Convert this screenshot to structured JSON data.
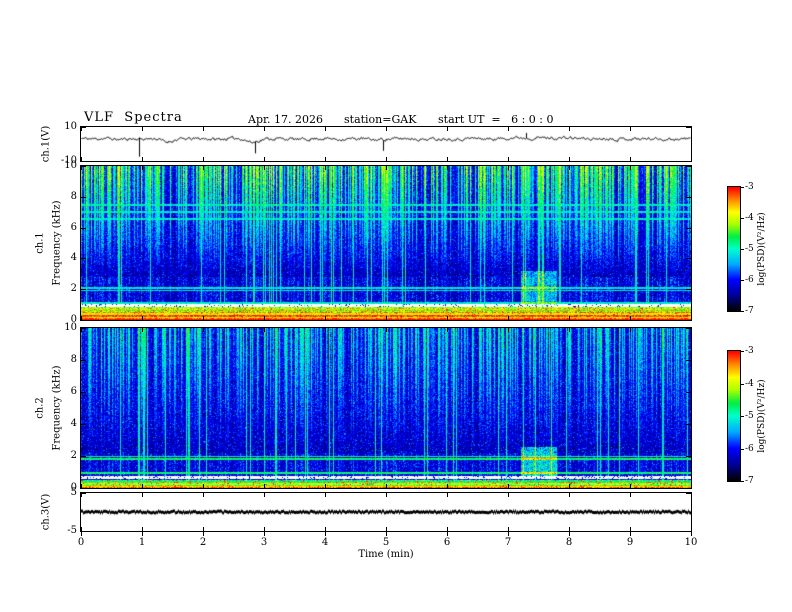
{
  "header": {
    "title": "VLF  Spectra",
    "date": "Apr. 17. 2026",
    "station": "station=GAK",
    "start_ut": "start UT  =   6 : 0 : 0"
  },
  "time_axis": {
    "label": "Time (min)",
    "min": 0,
    "max": 10,
    "tick_labels": [
      "0",
      "1",
      "2",
      "3",
      "4",
      "5",
      "6",
      "7",
      "8",
      "9",
      "10"
    ]
  },
  "colorbars": [
    {
      "label": "log(PSD)(V²/Hz)",
      "min": -7,
      "max": -3,
      "tick_labels": [
        "-3",
        "-4",
        "-5",
        "-6",
        "-7"
      ]
    },
    {
      "label": "log(PSD)(V²/Hz)",
      "min": -7,
      "max": -3,
      "tick_labels": [
        "-3",
        "-4",
        "-5",
        "-6",
        "-7"
      ]
    }
  ],
  "colormap_stops": [
    {
      "v": -7.0,
      "color": "#000000"
    },
    {
      "v": -6.5,
      "color": "#000099"
    },
    {
      "v": -6.0,
      "color": "#0000ff"
    },
    {
      "v": -5.5,
      "color": "#00aaff"
    },
    {
      "v": -5.0,
      "color": "#00ffcc"
    },
    {
      "v": -4.6,
      "color": "#00ee44"
    },
    {
      "v": -4.2,
      "color": "#aaff00"
    },
    {
      "v": -3.8,
      "color": "#ffff00"
    },
    {
      "v": -3.4,
      "color": "#ff8800"
    },
    {
      "v": -3.0,
      "color": "#ff0000"
    }
  ],
  "chart_data": [
    {
      "type": "line",
      "name": "ch1_voltage",
      "ylabel": "ch.1(V)",
      "ylim": [
        -10,
        10
      ],
      "ytick_labels": [
        "10",
        "-10"
      ],
      "description": "Noisy broadband voltage trace fluctuating around +3 V for the full 10 minutes, with brief downward excursions near t=1.4, 2.8 and 5 min and a slightly elevated level near t=7-8 min.",
      "seed": 11,
      "noise_amp": 1.5,
      "keyframes": [
        3.2,
        3.0,
        3.4,
        2.6,
        3.1,
        2.9,
        3.3,
        1.2,
        2.8,
        3.0,
        3.2,
        2.7,
        3.1,
        3.4,
        0.8,
        2.9,
        3.2,
        3.0,
        2.6,
        3.1,
        3.3,
        2.8,
        3.0,
        3.2,
        2.4,
        2.9,
        3.1,
        3.3,
        2.7,
        3.0,
        3.2,
        2.8,
        3.4,
        3.1,
        2.9,
        3.6,
        3.8,
        3.5,
        3.7,
        3.4,
        3.6,
        3.2,
        3.0,
        3.3,
        2.9,
        3.1,
        3.0,
        3.2,
        2.8,
        3.0,
        3.1
      ],
      "spikes": [
        {
          "t": 0.95,
          "v": -7.5
        },
        {
          "t": 2.85,
          "v": -5.5
        },
        {
          "t": 4.95,
          "v": -4.0
        },
        {
          "t": 7.3,
          "v": 6.5
        }
      ]
    },
    {
      "type": "heatmap",
      "name": "ch1_spectrogram",
      "channel": "ch.1",
      "ylabel": "Frequency (kHz)",
      "ylim": [
        0,
        10
      ],
      "ytick_labels": [
        "10",
        "8",
        "6",
        "4",
        "2",
        "0"
      ],
      "value_range": [
        -7,
        -3
      ],
      "units": "log10 PSD (V²/Hz)",
      "seed": 23,
      "features": {
        "background_psd": -6.85,
        "sferic_streaks": {
          "density": 0.9,
          "top_psd": -3.8,
          "low_freq_cutoff_khz": 2.8,
          "full_height_threshold": 0.93
        },
        "horizontal_lines_khz": [
          1.15,
          1.95,
          2.1,
          6.6,
          7.05,
          7.5
        ],
        "line_psd": -5.1,
        "white_gap_khz": [
          0.9,
          1.05
        ],
        "intense_band": {
          "freq_khz": [
            0,
            0.88
          ],
          "psd": -3.7,
          "red_speckle": 0.04
        },
        "enhancement": {
          "t_min": [
            7.2,
            7.8
          ],
          "freq_khz": [
            1.0,
            3.2
          ],
          "psd_boost": 1.1
        }
      },
      "description": "Dense vertical sferic striations (green/yellow) strongest above ~5 kHz on near-black background; scattered blue speckle below 3 kHz; thin cyan horizontal lines near 2 and 6.6-7.5 kHz; quasi-continuous intense red/yellow band below ~0.9 kHz with a white gap just above it; cyan enhancement near t=7.5 min at 1-3 kHz."
    },
    {
      "type": "heatmap",
      "name": "ch2_spectrogram",
      "channel": "ch.2",
      "ylabel": "Frequency (kHz)",
      "ylim": [
        0,
        10
      ],
      "ytick_labels": [
        "10",
        "8",
        "6",
        "4",
        "2",
        "0"
      ],
      "value_range": [
        -7,
        -3
      ],
      "units": "log10 PSD (V²/Hz)",
      "seed": 57,
      "features": {
        "background_psd": -6.8,
        "sferic_streaks": {
          "density": 0.6,
          "top_psd": -4.5,
          "low_freq_cutoff_khz": 2.2,
          "full_height_threshold": 0.9
        },
        "horizontal_lines_khz": [
          0.95,
          1.85,
          2.0
        ],
        "line_psd": -4.7,
        "white_gap_khz": [
          0.6,
          0.78
        ],
        "intense_band": {
          "freq_khz": [
            0,
            0.55
          ],
          "psd": -4.2,
          "red_speckle": 0.06
        },
        "enhancement": {
          "t_min": [
            7.2,
            7.8
          ],
          "freq_khz": [
            0.8,
            2.6
          ],
          "psd_boost": 1.3
        }
      },
      "description": "Blue-dominated spectrogram with vertical sferic streaks across all 10 minutes, bright green horizontal lines near 1 and 2 kHz, green/cyan band with red speckles below ~0.55 kHz, cyan enhancement near t=7.5 min."
    },
    {
      "type": "line",
      "name": "ch3_voltage",
      "ylabel": "ch.3(V)",
      "ylim": [
        -5,
        5
      ],
      "ytick_labels": [
        "5",
        "-5"
      ],
      "style": "dotted-flat",
      "mean": 0,
      "seed": 7,
      "noise_amp": 0.15,
      "description": "Flat thick dotted trace constant at 0 V for the full 10 minutes."
    }
  ]
}
